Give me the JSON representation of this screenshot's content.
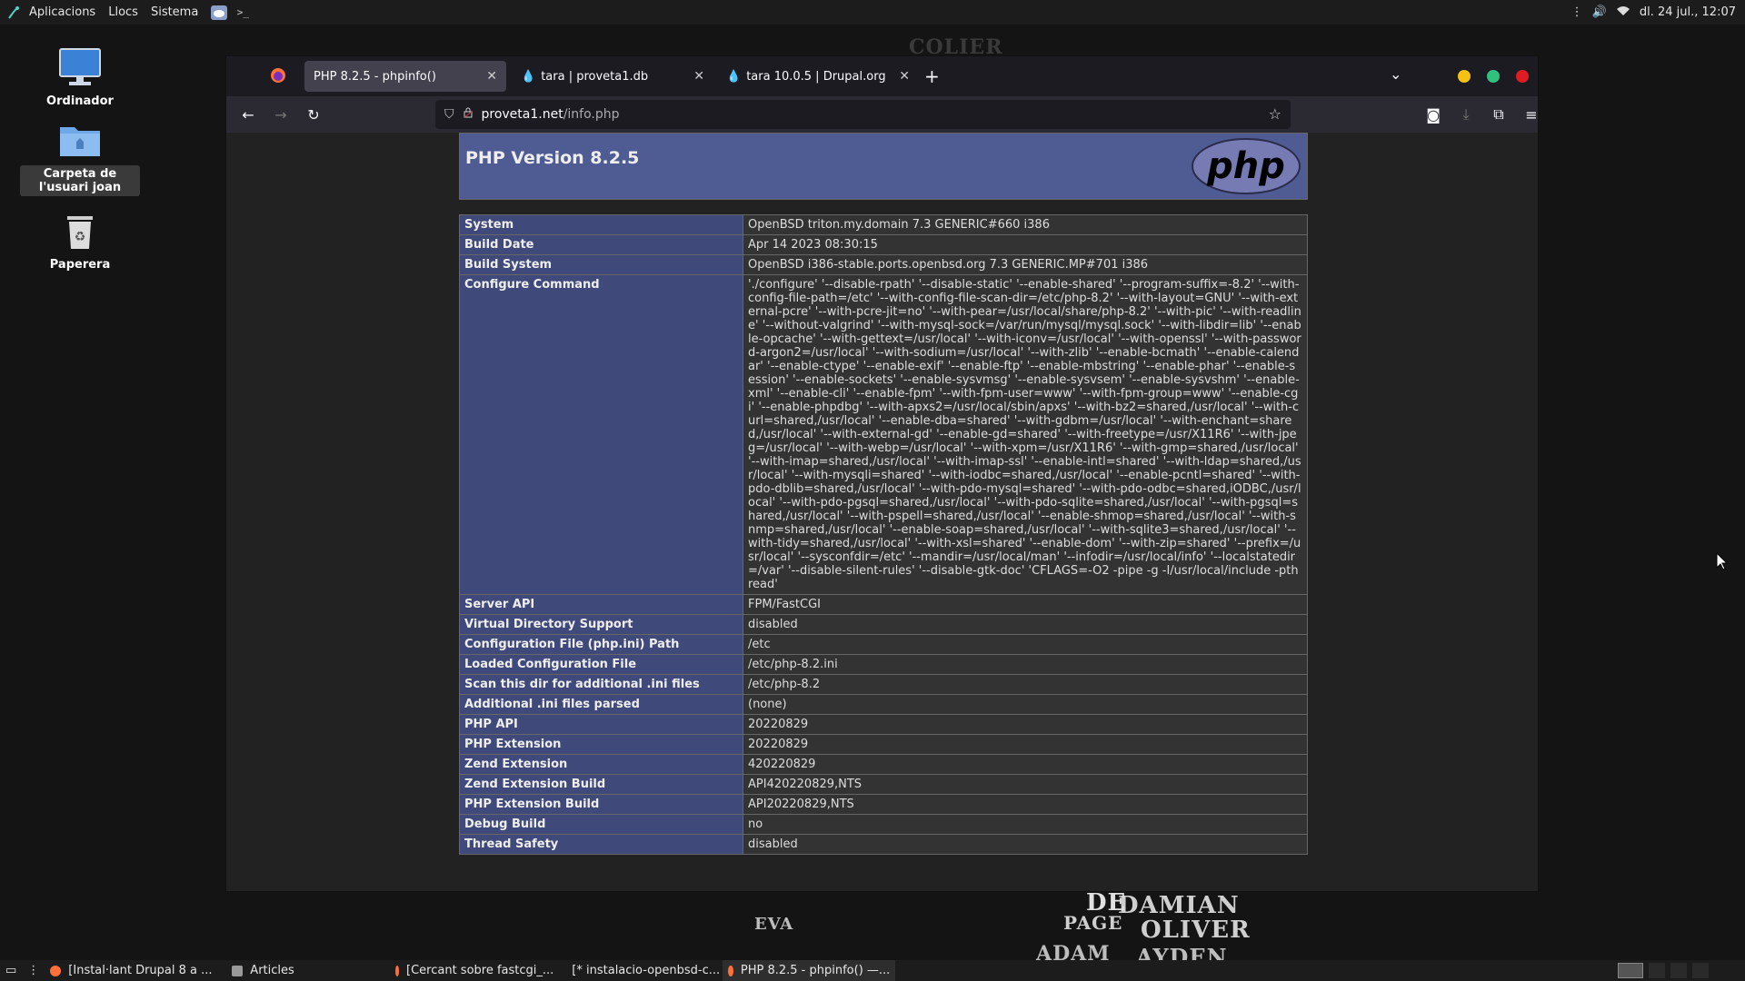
{
  "top_panel": {
    "menus": [
      "Aplicacions",
      "Llocs",
      "Sistema"
    ],
    "clock": "dl. 24 jul., 12:07"
  },
  "desktop": {
    "icons": [
      {
        "label": "Ordinador",
        "icon": "monitor-icon"
      },
      {
        "label": "Carpeta de l'usuari joan",
        "icon": "home-folder-icon"
      },
      {
        "label": "Paperera",
        "icon": "trash-icon"
      }
    ]
  },
  "browser": {
    "tabs": [
      {
        "title": "PHP 8.2.5 - phpinfo()",
        "active": true
      },
      {
        "title": "tara | proveta1.db",
        "active": false
      },
      {
        "title": "tara 10.0.5 | Drupal.org",
        "active": false
      }
    ],
    "url_host": "proveta1.net",
    "url_path": "/info.php",
    "colors": {
      "minimize": "#f5c211",
      "maximize": "#2ec27e",
      "close": "#e01b24"
    }
  },
  "phpinfo": {
    "title": "PHP Version 8.2.5",
    "logo_text": "php",
    "rows": [
      {
        "key": "System",
        "value": "OpenBSD triton.my.domain 7.3 GENERIC#660 i386"
      },
      {
        "key": "Build Date",
        "value": "Apr 14 2023 08:30:15"
      },
      {
        "key": "Build System",
        "value": "OpenBSD i386-stable.ports.openbsd.org 7.3 GENERIC.MP#701 i386"
      },
      {
        "key": "Configure Command",
        "value": "'./configure' '--disable-rpath' '--disable-static' '--enable-shared' '--program-suffix=-8.2' '--with-config-file-path=/etc' '--with-config-file-scan-dir=/etc/php-8.2' '--with-layout=GNU' '--with-external-pcre' '--with-pcre-jit=no' '--with-pear=/usr/local/share/php-8.2' '--with-pic' '--with-readline' '--without-valgrind' '--with-mysql-sock=/var/run/mysql/mysql.sock' '--with-libdir=lib' '--enable-opcache' '--with-gettext=/usr/local' '--with-iconv=/usr/local' '--with-openssl' '--with-password-argon2=/usr/local' '--with-sodium=/usr/local' '--with-zlib' '--enable-bcmath' '--enable-calendar' '--enable-ctype' '--enable-exif' '--enable-ftp' '--enable-mbstring' '--enable-phar' '--enable-session' '--enable-sockets' '--enable-sysvmsg' '--enable-sysvsem' '--enable-sysvshm' '--enable-xml' '--enable-cli' '--enable-fpm' '--with-fpm-user=www' '--with-fpm-group=www' '--enable-cgi' '--enable-phpdbg' '--with-apxs2=/usr/local/sbin/apxs' '--with-bz2=shared,/usr/local' '--with-curl=shared,/usr/local' '--enable-dba=shared' '--with-gdbm=/usr/local' '--with-enchant=shared,/usr/local' '--with-external-gd' '--enable-gd=shared' '--with-freetype=/usr/X11R6' '--with-jpeg=/usr/local' '--with-webp=/usr/local' '--with-xpm=/usr/X11R6' '--with-gmp=shared,/usr/local' '--with-imap=shared,/usr/local' '--with-imap-ssl' '--enable-intl=shared' '--with-ldap=shared,/usr/local' '--with-mysqli=shared' '--with-iodbc=shared,/usr/local' '--enable-pcntl=shared' '--with-pdo-dblib=shared,/usr/local' '--with-pdo-mysql=shared' '--with-pdo-odbc=shared,iODBC,/usr/local' '--with-pdo-pgsql=shared,/usr/local' '--with-pdo-sqlite=shared,/usr/local' '--with-pgsql=shared,/usr/local' '--with-pspell=shared,/usr/local' '--enable-shmop=shared,/usr/local' '--with-snmp=shared,/usr/local' '--enable-soap=shared,/usr/local' '--with-sqlite3=shared,/usr/local' '--with-tidy=shared,/usr/local' '--with-xsl=shared' '--enable-dom' '--with-zip=shared' '--prefix=/usr/local' '--sysconfdir=/etc' '--mandir=/usr/local/man' '--infodir=/usr/local/info' '--localstatedir=/var' '--disable-silent-rules' '--disable-gtk-doc' 'CFLAGS=-O2 -pipe -g -I/usr/local/include -pthread'"
      },
      {
        "key": "Server API",
        "value": "FPM/FastCGI"
      },
      {
        "key": "Virtual Directory Support",
        "value": "disabled"
      },
      {
        "key": "Configuration File (php.ini) Path",
        "value": "/etc"
      },
      {
        "key": "Loaded Configuration File",
        "value": "/etc/php-8.2.ini"
      },
      {
        "key": "Scan this dir for additional .ini files",
        "value": "/etc/php-8.2"
      },
      {
        "key": "Additional .ini files parsed",
        "value": "(none)"
      },
      {
        "key": "PHP API",
        "value": "20220829"
      },
      {
        "key": "PHP Extension",
        "value": "20220829"
      },
      {
        "key": "Zend Extension",
        "value": "420220829"
      },
      {
        "key": "Zend Extension Build",
        "value": "API420220829,NTS"
      },
      {
        "key": "PHP Extension Build",
        "value": "API20220829,NTS"
      },
      {
        "key": "Debug Build",
        "value": "no"
      },
      {
        "key": "Thread Safety",
        "value": "disabled"
      }
    ]
  },
  "taskbar": {
    "items": [
      {
        "label": "[Instal·lant Drupal 8 a ...",
        "active": false
      },
      {
        "label": "Articles",
        "active": false
      },
      {
        "label": "[Cercant sobre fastcgi_...",
        "active": false
      },
      {
        "label": "[* instalacio-openbsd-c...",
        "active": false
      },
      {
        "label": "PHP 8.2.5 - phpinfo() —...",
        "active": true
      }
    ]
  },
  "wallpaper": {
    "words": [
      "DAMIAN",
      "OLIVER",
      "AYDEN",
      "PAGE",
      "EVA",
      "ADAM",
      "DE",
      "COLIER"
    ]
  }
}
